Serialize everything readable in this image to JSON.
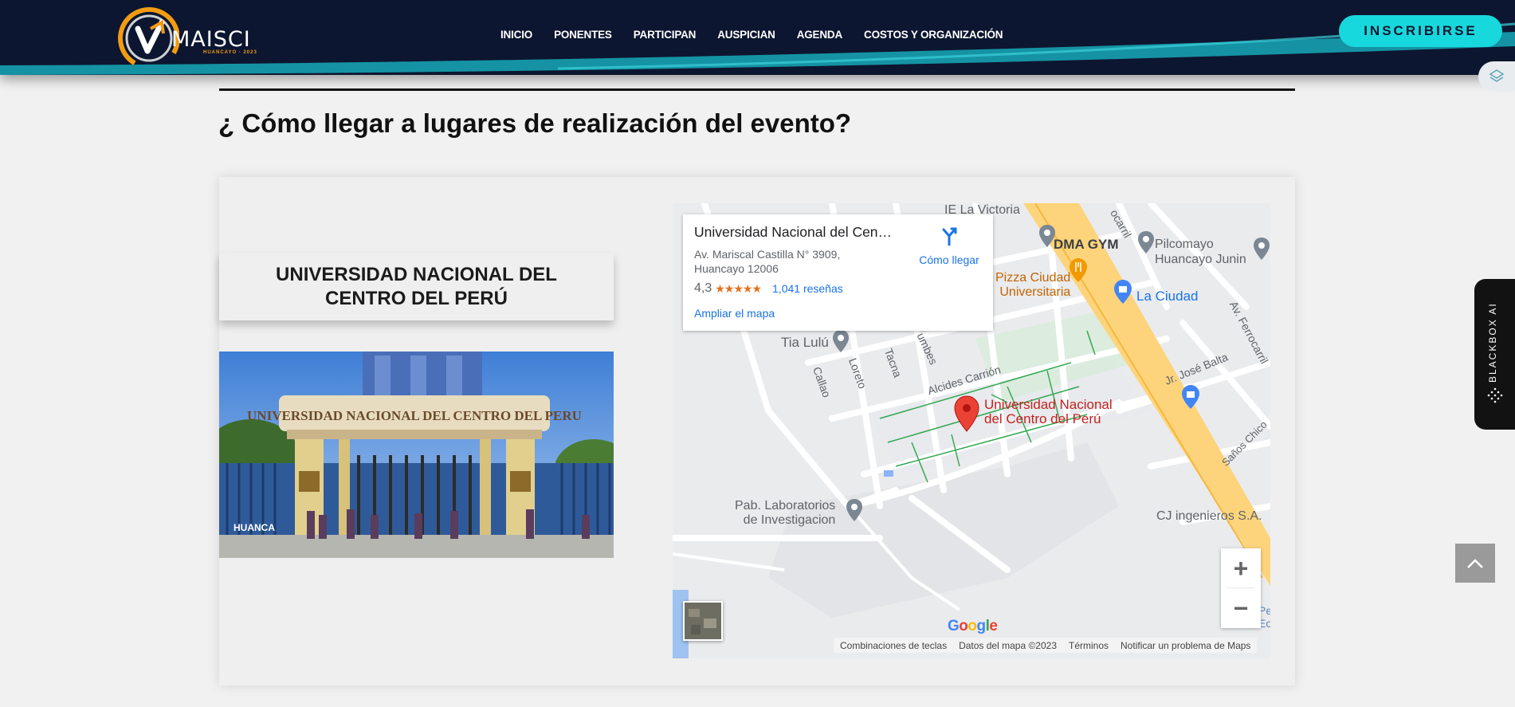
{
  "header": {
    "logo_text": "MAISCI",
    "logo_sub": "HUANCAYO · 2023",
    "nav": [
      "INICIO",
      "PONENTES",
      "PARTICIPAN",
      "AUSPICIAN",
      "AGENDA",
      "COSTOS Y ORGANIZACIÓN"
    ],
    "cta_label": "INSCRIBIRSE"
  },
  "section": {
    "title": "¿ Cómo llegar a lugares de realización del evento?"
  },
  "venue": {
    "name": "UNIVERSIDAD NACIONAL DEL CENTRO DEL PERÚ",
    "photo_sign": "UNIVERSIDAD NACIONAL DEL CENTRO DEL PERU"
  },
  "map": {
    "place_name": "Universidad Nacional del Centro del Perú",
    "address": "Av. Mariscal Castilla N° 3909, Huancayo 12006",
    "rating": "4,3",
    "stars": "★★★★★",
    "reviews": "1,041 reseñas",
    "directions": "Cómo llegar",
    "enlarge": "Ampliar el mapa",
    "marker_label_1": "Universidad Nacional",
    "marker_label_2": "del Centro del Perú",
    "labels": {
      "ie_victoria": "IE La Victoria",
      "dma_gym": "DMA GYM",
      "pilcomayo_1": "Pilcomayo",
      "pilcomayo_2": "Huancayo Junin",
      "pizza_1": "Pizza Ciudad",
      "pizza_2": "Universitaria",
      "la_ciudad": "La Ciudad",
      "tia_lulu": "Tia Lulú",
      "callao": "Callao",
      "loreto": "Loreto",
      "tacna": "Tacna",
      "tumbes": "umbes",
      "alcides": "Alcides Carrión",
      "jose_balta": "Jr. José Balta",
      "ferrocarril": "Av. Ferrocarril",
      "ferrocarril_top": "ocarril",
      "sanos_chico": "Saños Chico",
      "pab_1": "Pab. Laboratorios",
      "pab_2": "de Investigacion",
      "cj": "CJ ingenieros S.A.",
      "pe_1": "Pe",
      "pe_2": "Eoo"
    },
    "zoom_in": "+",
    "zoom_out": "−",
    "google": "Google",
    "attribution": [
      "Combinaciones de teclas",
      "Datos del mapa ©2023",
      "Términos",
      "Notificar un problema de Maps"
    ]
  },
  "widgets": {
    "blackbox_label": "BLACKBOX AI"
  }
}
